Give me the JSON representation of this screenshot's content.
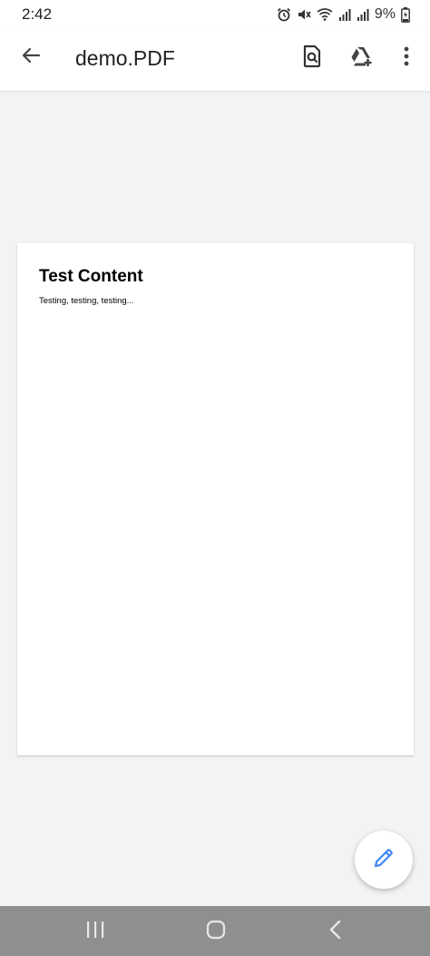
{
  "status_bar": {
    "time": "2:42",
    "battery_percent": "9%",
    "icons": [
      "alarm-icon",
      "mute-icon",
      "wifi-icon",
      "signal-icon",
      "signal-icon",
      "battery-charging-icon"
    ]
  },
  "app_bar": {
    "title": "demo.PDF",
    "back_icon": "arrow-left-icon",
    "find_icon": "find-in-page-icon",
    "drive_icon": "add-to-drive-icon",
    "more_icon": "more-vert-icon"
  },
  "document": {
    "heading": "Test Content",
    "body": "Testing, testing, testing..."
  },
  "fab": {
    "icon": "pencil-icon",
    "color": "#4285f4"
  },
  "nav_bar": {
    "recents_icon": "recents-icon",
    "home_icon": "home-icon",
    "back_icon": "back-chevron-icon"
  },
  "colors": {
    "background": "#f1f3f4",
    "app_bar": "#ffffff",
    "nav_bar": "#8e8f8f",
    "accent": "#4285f4"
  }
}
